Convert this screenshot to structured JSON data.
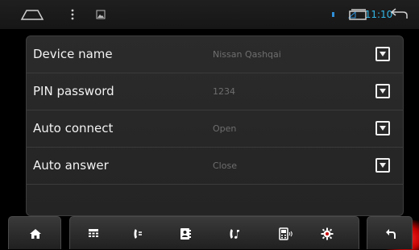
{
  "status_bar": {
    "time": "11:10",
    "icons": [
      "home-outline-icon",
      "menu-dots-icon",
      "image-icon",
      "bluetooth-dot-icon",
      "signal-icon",
      "recent-apps-icon",
      "back-icon"
    ],
    "time_color": "#33b5e5"
  },
  "settings": {
    "rows": [
      {
        "label": "Device name",
        "value": "Nissan Qashqai"
      },
      {
        "label": "PIN password",
        "value": "1234"
      },
      {
        "label": "Auto connect",
        "value": "Open"
      },
      {
        "label": "Auto answer",
        "value": "Close"
      }
    ]
  },
  "bottom_bar": {
    "items": [
      "home-icon",
      "keypad-icon",
      "call-log-icon",
      "contacts-icon",
      "music-icon",
      "device-icon",
      "settings-icon",
      "back-icon"
    ],
    "active": "settings-icon",
    "active_color": "#e00000"
  }
}
